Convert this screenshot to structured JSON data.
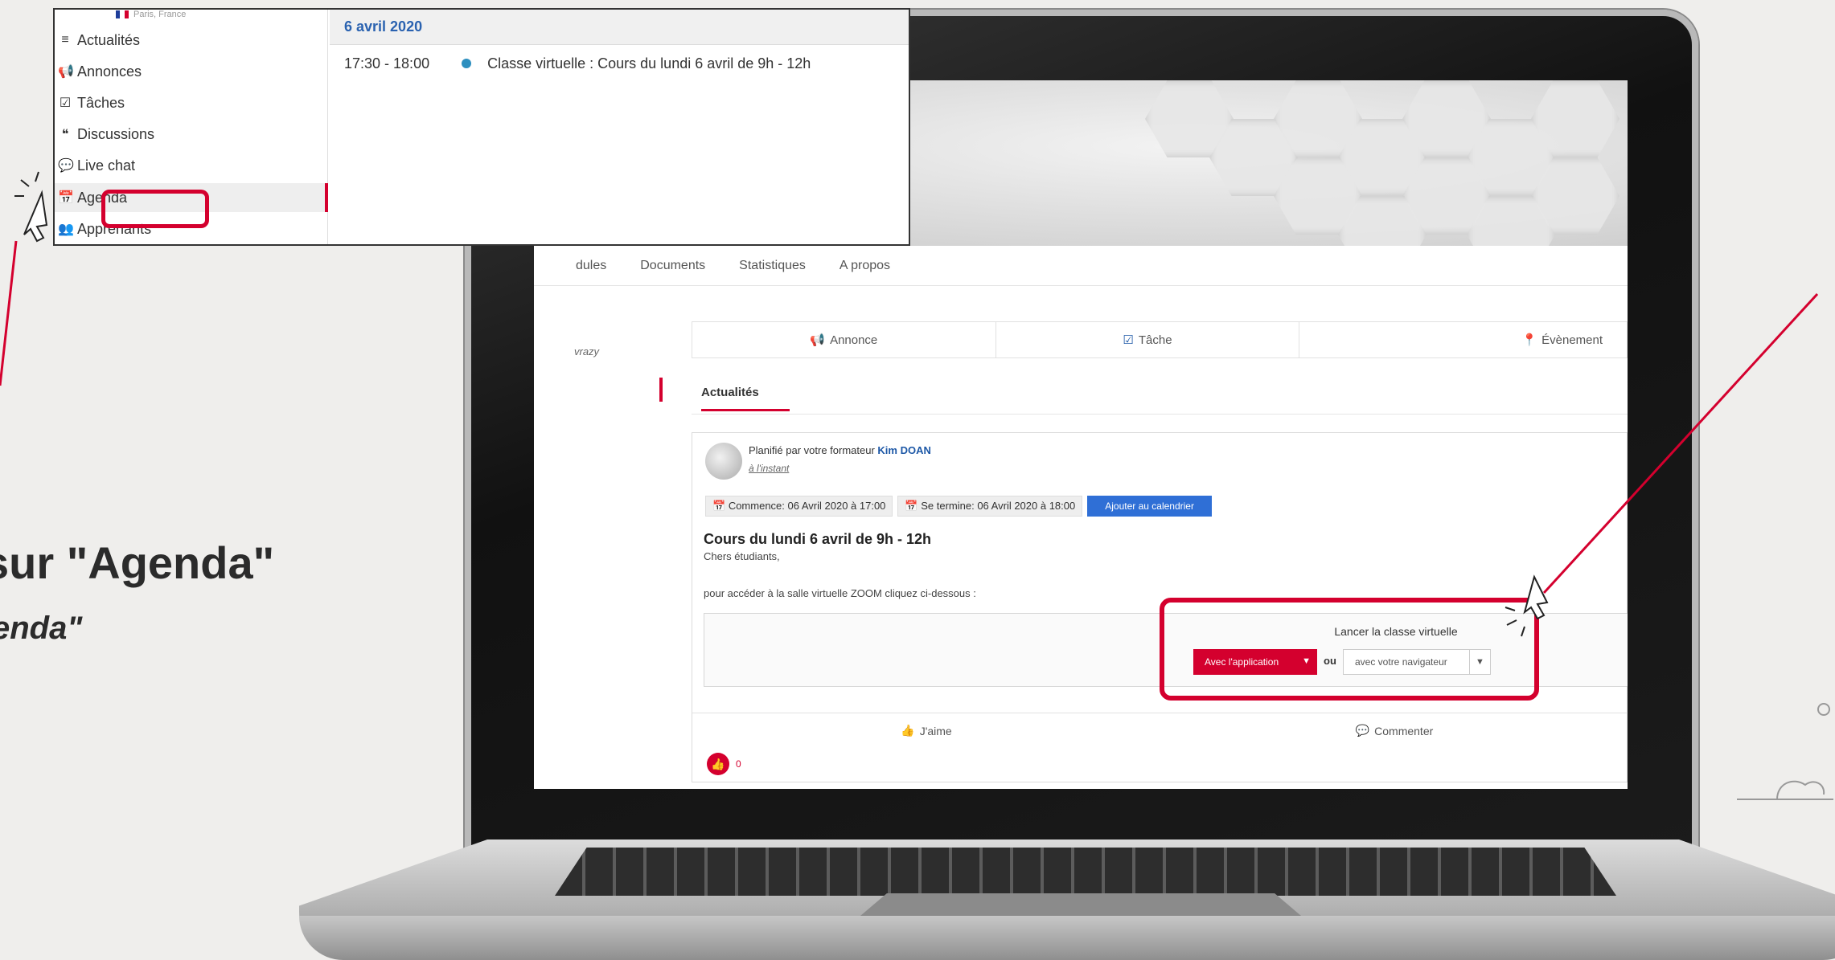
{
  "caption": {
    "main": "sur \"Agenda\"",
    "sub": "enda\""
  },
  "popup": {
    "location": "Paris, France",
    "sidebar": [
      {
        "icon": "list-icon",
        "glyph": "≡",
        "label": "Actualités"
      },
      {
        "icon": "megaphone-icon",
        "glyph": "📢",
        "label": "Annonces"
      },
      {
        "icon": "checkbox-icon",
        "glyph": "☑",
        "label": "Tâches"
      },
      {
        "icon": "quote-icon",
        "glyph": "❝",
        "label": "Discussions"
      },
      {
        "icon": "chat-bubble-icon",
        "glyph": "💬",
        "label": "Live chat"
      },
      {
        "icon": "calendar-icon",
        "glyph": "📅",
        "label": "Agenda"
      },
      {
        "icon": "users-icon",
        "glyph": "👥",
        "label": "Apprenants"
      }
    ],
    "calendar": {
      "date": "6 avril 2020",
      "event_time": "17:30 - 18:00",
      "event_title": "Classe virtuelle : Cours du lundi 6 avril de 9h - 12h"
    }
  },
  "screen": {
    "tabs": [
      "dules",
      "Documents",
      "Statistiques",
      "A propos"
    ],
    "left_label": "vrazy",
    "actions": {
      "annonce": "Annonce",
      "tache": "Tâche",
      "evenement": "Évènement"
    },
    "feed_tab": "Actualités",
    "post": {
      "planned_by": "Planifié par votre formateur",
      "author": "Kim DOAN",
      "time": "à l'instant",
      "start": "Commence: 06 Avril 2020 à 17:00",
      "end": "Se termine: 06 Avril 2020 à 18:00",
      "add_calendar": "Ajouter au calendrier",
      "title": "Cours du lundi 6 avril de 9h - 12h",
      "greeting": "Chers étudiants,",
      "body": "pour accéder à la salle virtuelle ZOOM cliquez ci-dessous :",
      "launch_title": "Lancer la classe virtuelle",
      "app_button": "Avec l'application",
      "or": "ou",
      "browser_button": "avec votre navigateur",
      "like": "J'aime",
      "comment": "Commenter",
      "like_count": "0"
    }
  },
  "colors": {
    "accent": "#d4002e",
    "link": "#1c57a6",
    "calendar_button": "#2f6fd6"
  }
}
